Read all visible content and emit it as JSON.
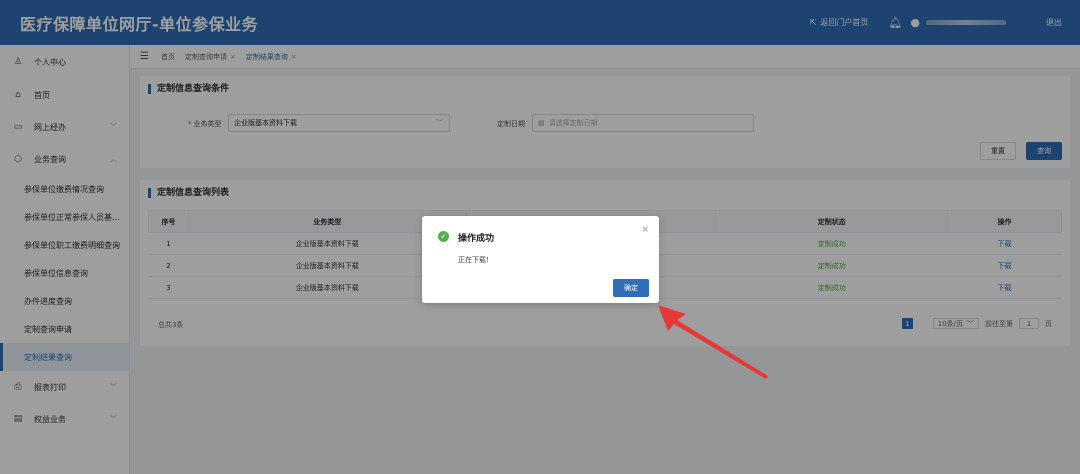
{
  "header": {
    "title": "医疗保障单位网厅-单位参保业务",
    "portal_link": "返回门户首页",
    "logout": "退出"
  },
  "sidebar": {
    "profile": "个人中心",
    "items": [
      {
        "label": "首页",
        "icon": "home-icon"
      },
      {
        "label": "网上经办",
        "icon": "inbox-icon"
      },
      {
        "label": "业务查询",
        "icon": "search-icon"
      }
    ],
    "sub_items": [
      "参保单位缴费情况查询",
      "参保单位正常参保人员基...",
      "参保单位职工缴费明细查询",
      "参保单位信息查询",
      "办件进度查询",
      "定制查询申请",
      "定制结果查询"
    ],
    "bottom_items": [
      {
        "label": "报表打印",
        "icon": "printer-icon"
      },
      {
        "label": "权益业务",
        "icon": "document-icon"
      }
    ]
  },
  "breadcrumb": {
    "home": "首页",
    "tab1": "定制查询申请",
    "tab2": "定制结果查询"
  },
  "query_panel": {
    "title": "定制信息查询条件",
    "business_type_label": "业务类型",
    "business_type_value": "企业版基本资料下载",
    "date_label": "定制日期",
    "date_placeholder": "请选择定制日期",
    "reset_label": "重置",
    "query_label": "查询"
  },
  "list_panel": {
    "title": "定制信息查询列表",
    "columns": [
      "序号",
      "业务类型",
      "",
      "定制状态",
      "操作"
    ],
    "rows": [
      {
        "no": "1",
        "type": "企业版基本资料下载",
        "status": "定制成功",
        "action": "下载"
      },
      {
        "no": "2",
        "type": "企业版基本资料下载",
        "status": "定制成功",
        "action": "下载"
      },
      {
        "no": "3",
        "type": "企业版基本资料下载",
        "status": "定制成功",
        "action": "下载"
      }
    ],
    "total": "总共3条",
    "page": "1",
    "page_size": "10条/页",
    "goto_prefix": "前往至第",
    "goto_value": "1",
    "goto_suffix": "页"
  },
  "dialog": {
    "title": "操作成功",
    "message": "正在下载!",
    "ok_label": "确定"
  },
  "colors": {
    "primary": "#2f6fb6",
    "success": "#52b04a",
    "annotation_arrow": "#e53935"
  }
}
